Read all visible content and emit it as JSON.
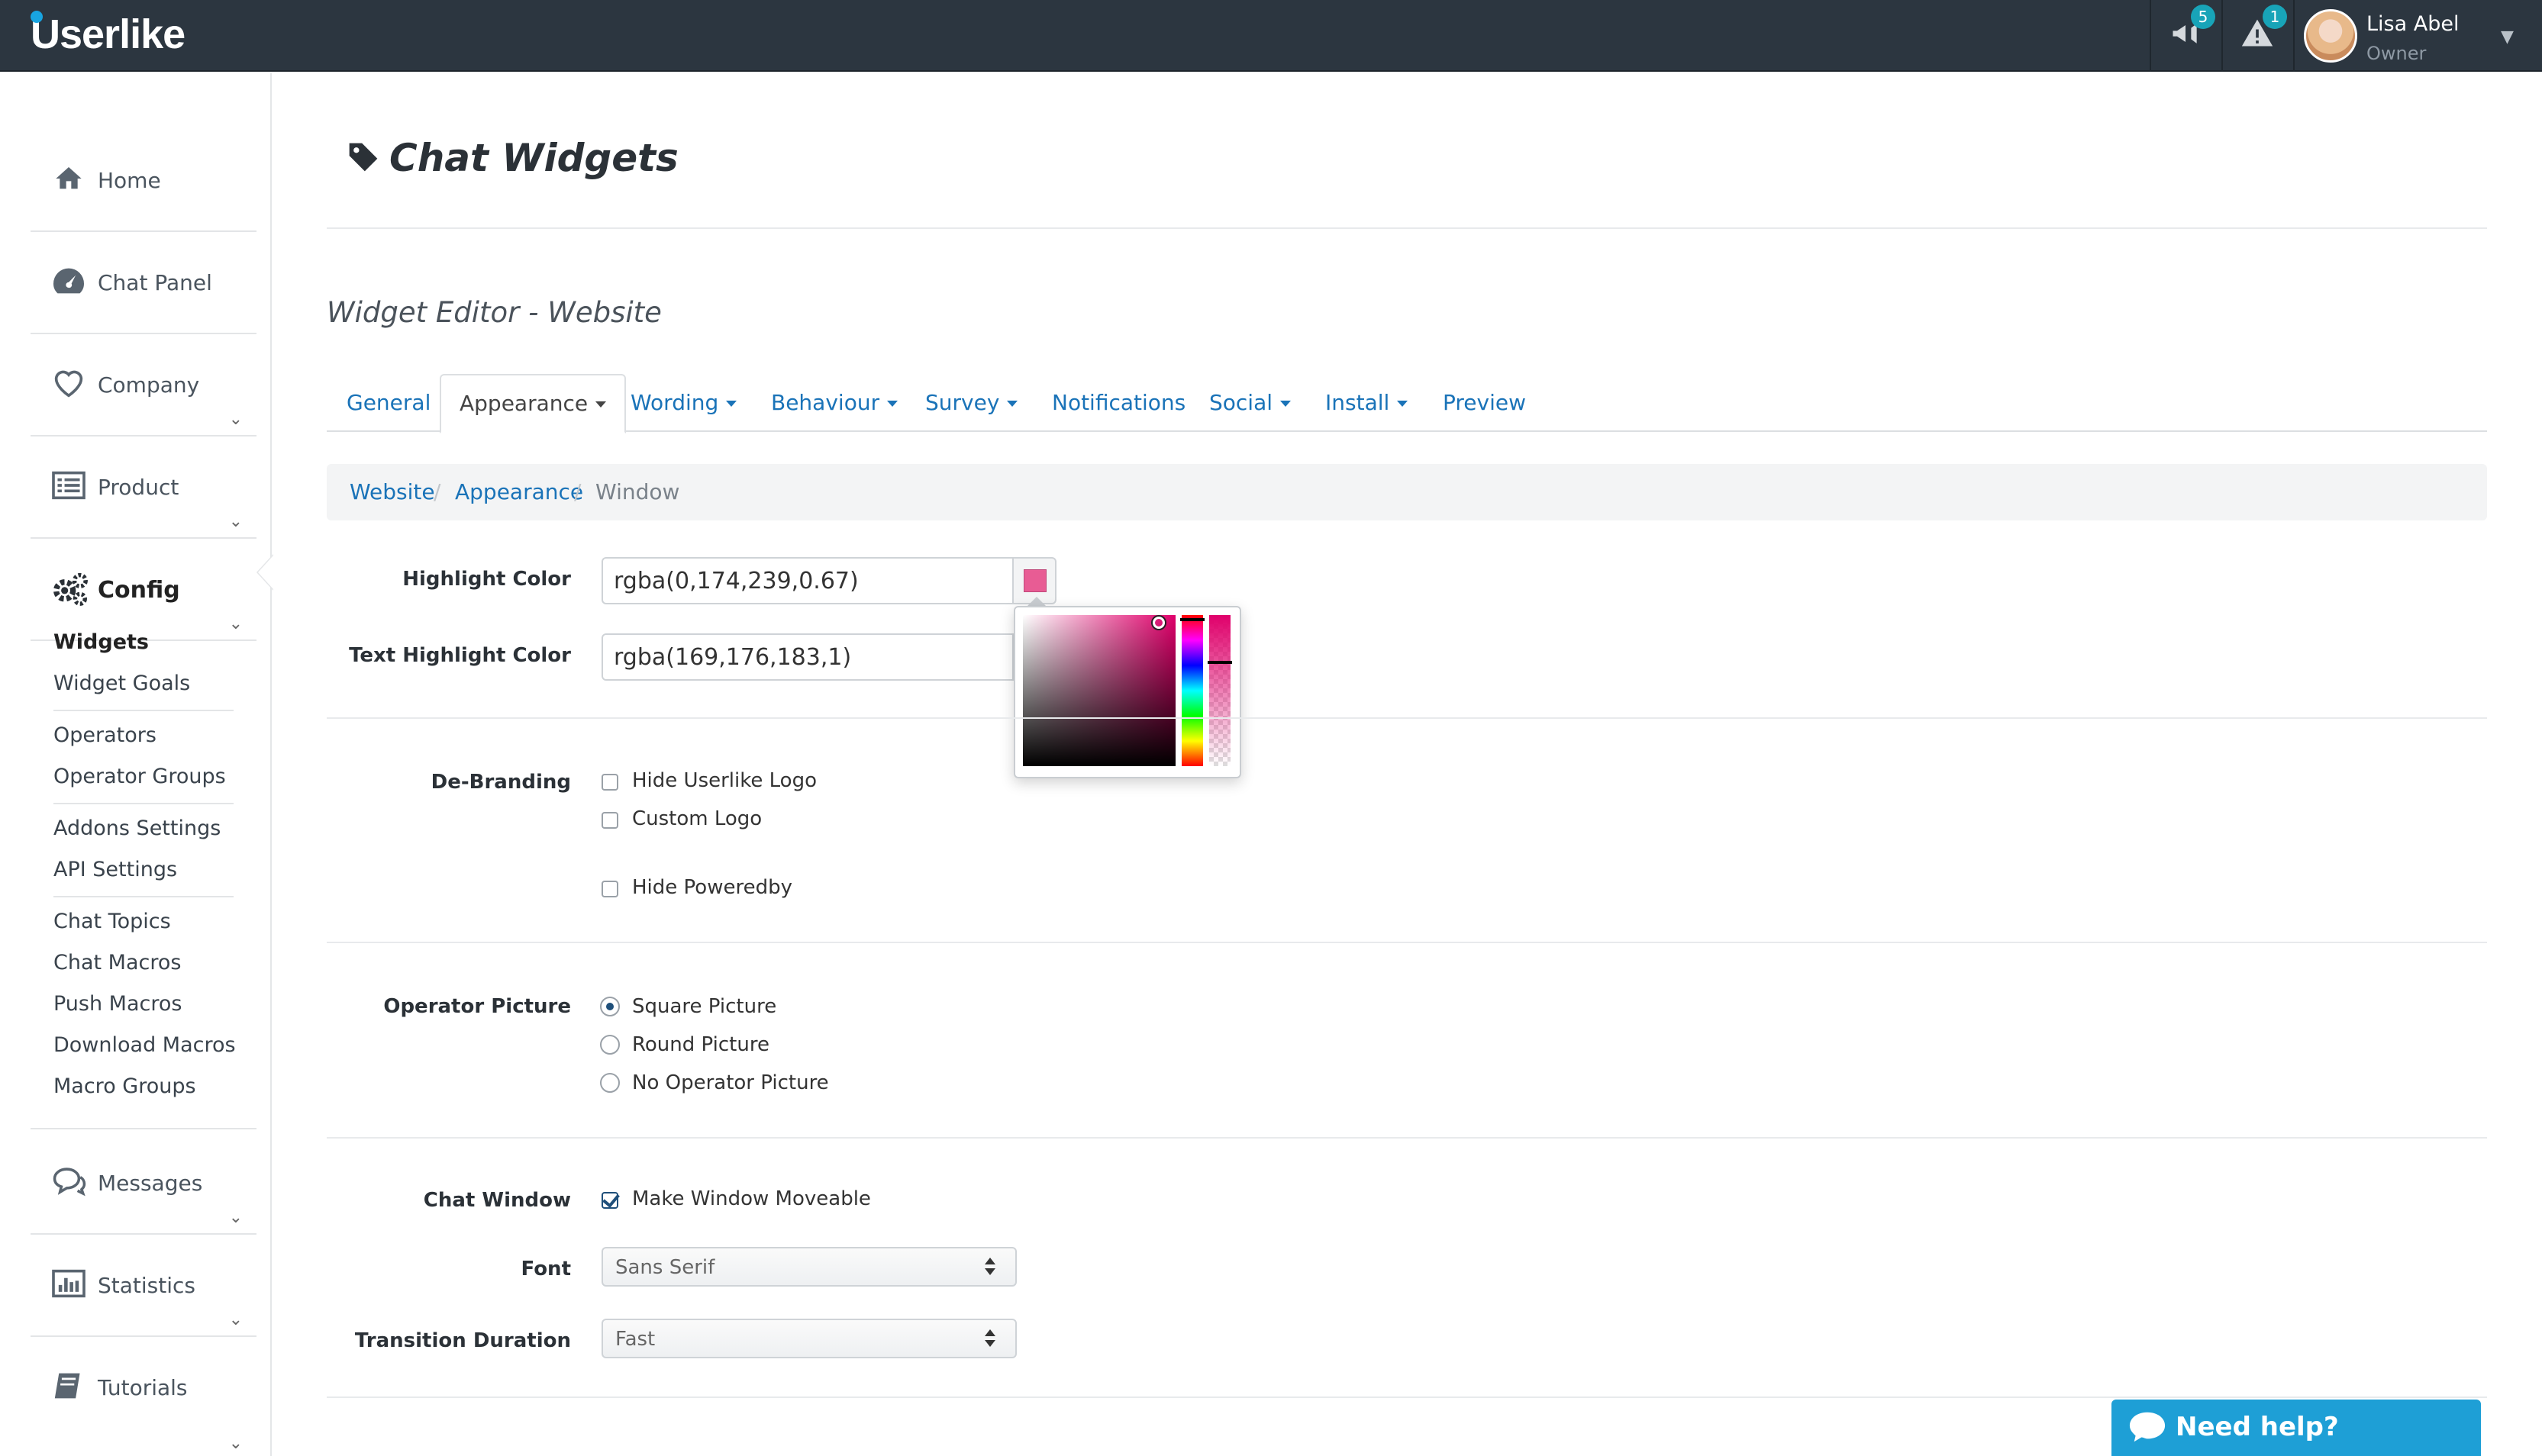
{
  "app": {
    "logo": "Userlike"
  },
  "topbar": {
    "announcements_badge": "5",
    "alerts_badge": "1",
    "user": {
      "name": "Lisa Abel",
      "role": "Owner"
    }
  },
  "sidebar": {
    "main": [
      {
        "label": "Home",
        "icon": "home-icon"
      },
      {
        "label": "Chat Panel",
        "icon": "dashboard-icon"
      },
      {
        "label": "Company",
        "icon": "heart-icon"
      },
      {
        "label": "Product",
        "icon": "list-icon"
      },
      {
        "label": "Config",
        "icon": "gears-icon"
      },
      {
        "label": "Messages",
        "icon": "chat-bubbles-icon"
      },
      {
        "label": "Statistics",
        "icon": "bar-chart-icon"
      },
      {
        "label": "Tutorials",
        "icon": "book-icon"
      }
    ],
    "config_items": [
      "Widgets",
      "Widget Goals",
      "Operators",
      "Operator Groups",
      "Addons Settings",
      "API Settings",
      "Chat Topics",
      "Chat Macros",
      "Push Macros",
      "Download Macros",
      "Macro Groups"
    ]
  },
  "main": {
    "title": "Chat Widgets",
    "subtitle": "Widget Editor - Website",
    "tabs": [
      "General",
      "Appearance",
      "Wording",
      "Behaviour",
      "Survey",
      "Notifications",
      "Social",
      "Install",
      "Preview"
    ],
    "breadcrumb": [
      "Website",
      "Appearance",
      "Window"
    ],
    "highlight_color": {
      "label": "Highlight Color",
      "value": "rgba(0,174,239,0.67)",
      "swatch": "#e85c94"
    },
    "text_highlight_color": {
      "label": "Text Highlight Color",
      "value": "rgba(169,176,183,1)"
    },
    "debranding": {
      "label": "De-Branding",
      "options": [
        "Hide Userlike Logo",
        "Custom Logo",
        "Hide Poweredby"
      ]
    },
    "operator_picture": {
      "label": "Operator Picture",
      "options": [
        "Square Picture",
        "Round Picture",
        "No Operator Picture"
      ],
      "selected": "Square Picture"
    },
    "chat_window": {
      "label": "Chat Window",
      "option": "Make Window Moveable"
    },
    "font": {
      "label": "Font",
      "value": "Sans Serif"
    },
    "transition": {
      "label": "Transition Duration",
      "value": "Fast"
    }
  },
  "help": {
    "label": "Need help?"
  }
}
